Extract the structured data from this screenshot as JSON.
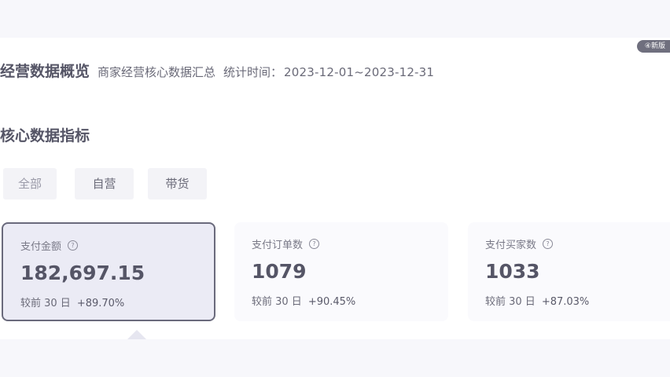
{
  "corner_badge": "④新版",
  "header": {
    "title": "经营数据概览",
    "subtitle": "商家经营核心数据汇总",
    "period_label": "统计时间：",
    "period_value": "2023-12-01~2023-12-31"
  },
  "section": {
    "title": "核心数据指标"
  },
  "tabs": [
    {
      "label": "全部",
      "active": true
    },
    {
      "label": "自营",
      "active": false
    },
    {
      "label": "带货",
      "active": false
    }
  ],
  "cards": [
    {
      "title": "支付金额",
      "value": "182,697.15",
      "compare_label": "较前 30 日",
      "change": "+89.70%",
      "selected": true
    },
    {
      "title": "支付订单数",
      "value": "1079",
      "compare_label": "较前 30 日",
      "change": "+90.45%",
      "selected": false
    },
    {
      "title": "支付买家数",
      "value": "1033",
      "compare_label": "较前 30 日",
      "change": "+87.03%",
      "selected": false
    }
  ],
  "colors": {
    "text_primary": "#555566",
    "selected_border": "#6a6a7c",
    "selected_bg": "#ebebf5"
  }
}
